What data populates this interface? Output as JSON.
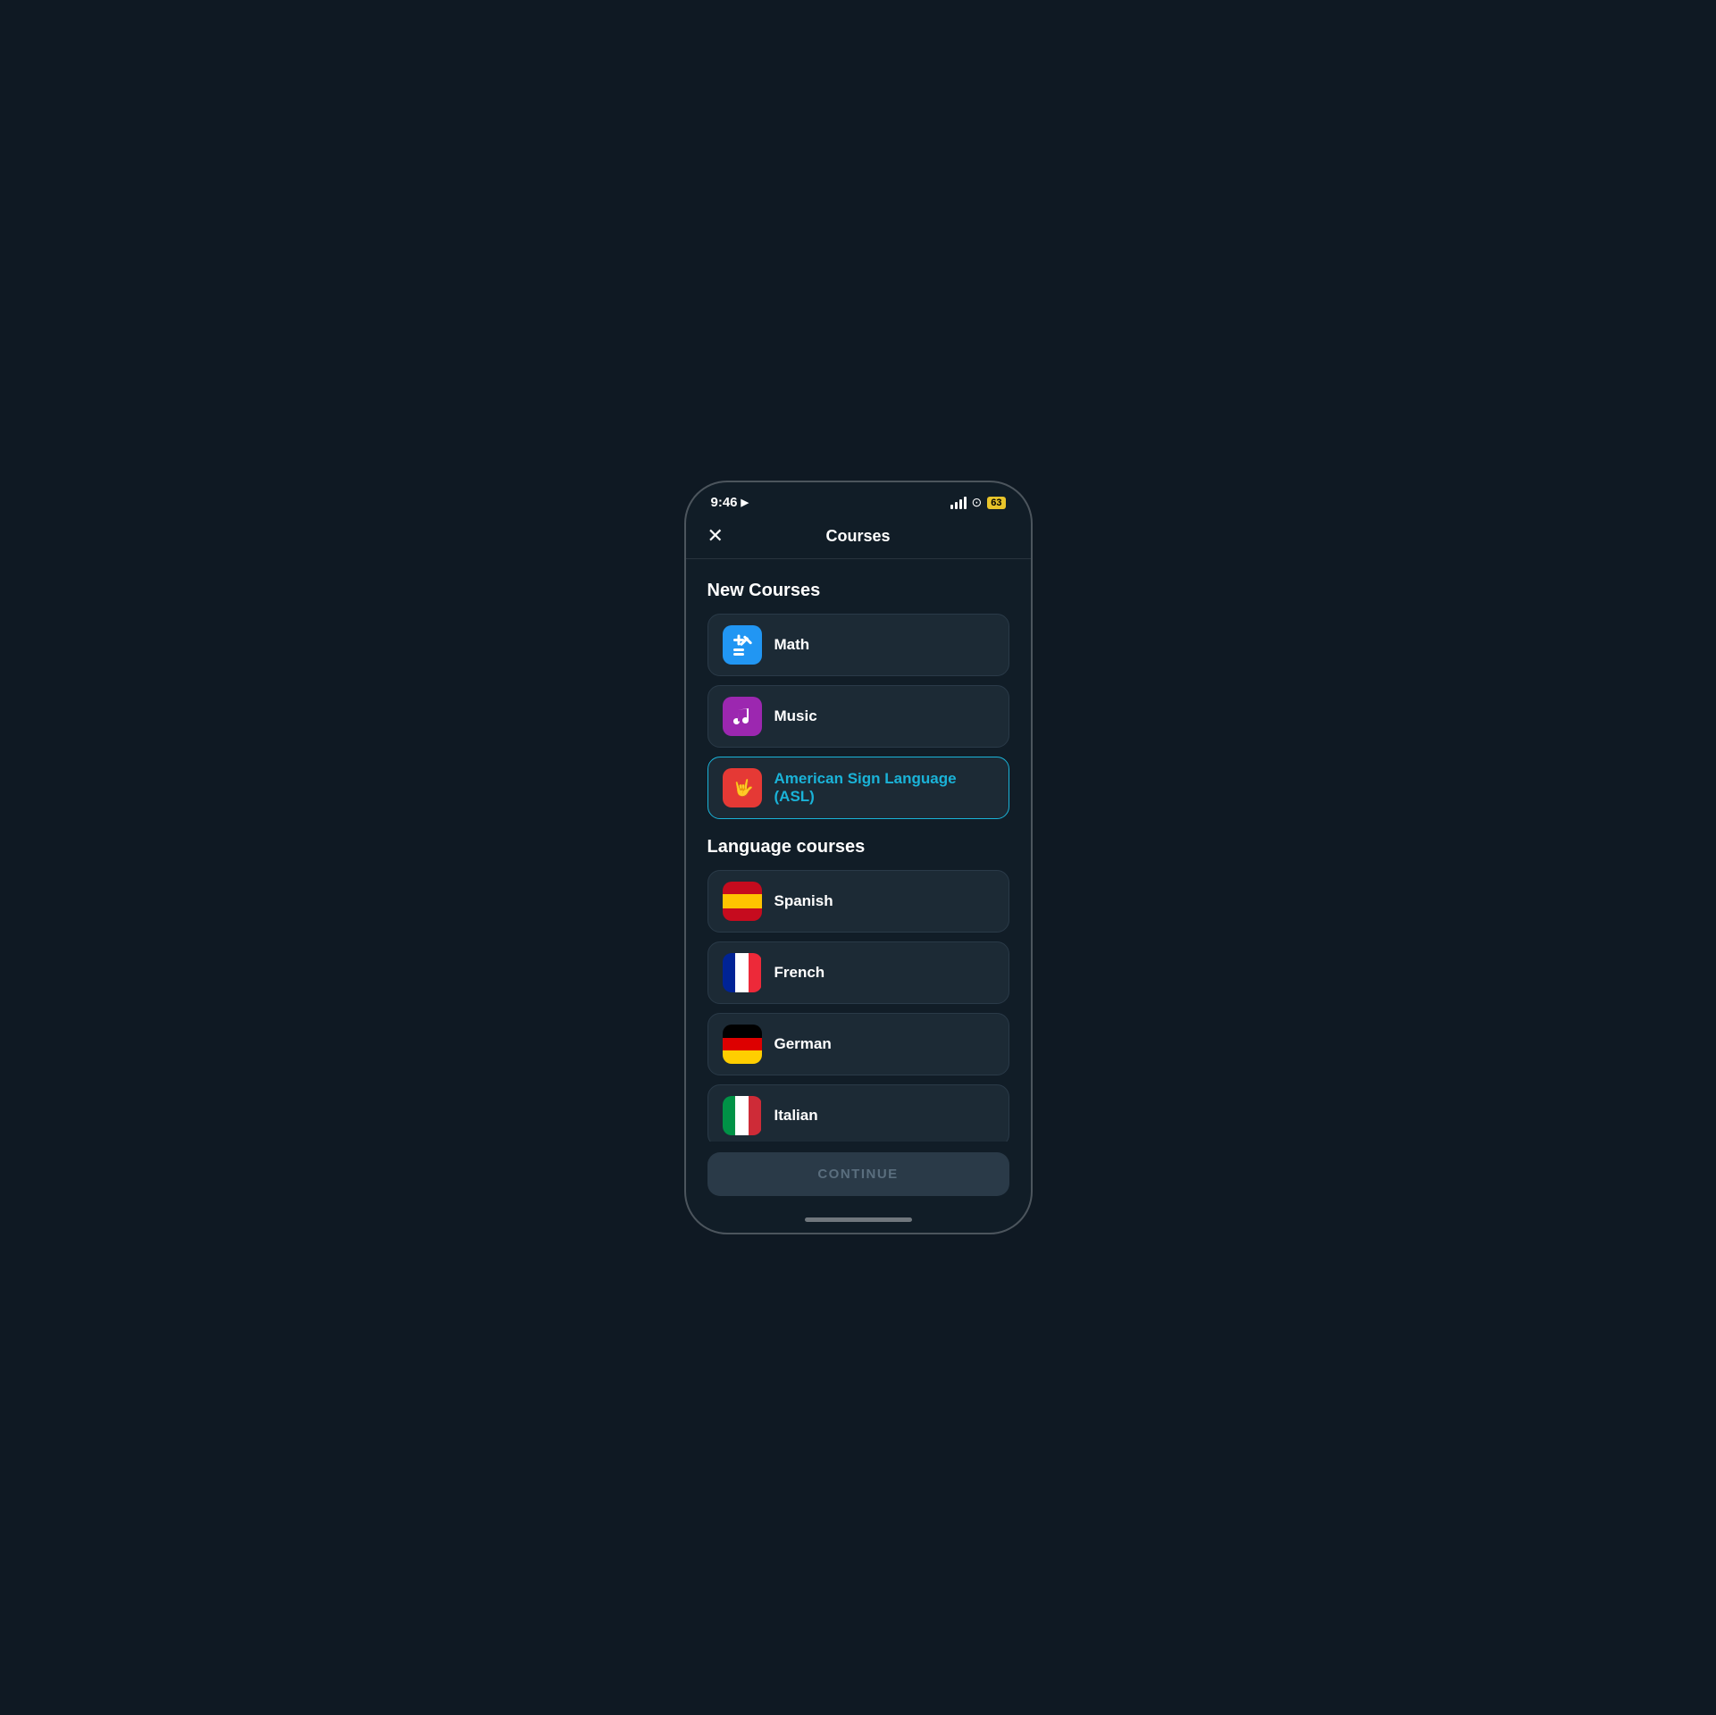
{
  "statusBar": {
    "time": "9:46",
    "battery": "63"
  },
  "header": {
    "title": "Courses",
    "closeLabel": "×"
  },
  "newCourses": {
    "sectionTitle": "New Courses",
    "items": [
      {
        "id": "math",
        "label": "Math",
        "iconType": "math",
        "selected": false
      },
      {
        "id": "music",
        "label": "Music",
        "iconType": "music",
        "selected": false
      },
      {
        "id": "asl",
        "label": "American Sign Language (ASL)",
        "iconType": "asl",
        "selected": true
      }
    ]
  },
  "languageCourses": {
    "sectionTitle": "Language courses",
    "items": [
      {
        "id": "spanish",
        "label": "Spanish",
        "flagType": "spanish",
        "selected": false
      },
      {
        "id": "french",
        "label": "French",
        "flagType": "french",
        "selected": false
      },
      {
        "id": "german",
        "label": "German",
        "flagType": "german",
        "selected": false
      },
      {
        "id": "italian",
        "label": "Italian",
        "flagType": "italian",
        "selected": false
      }
    ]
  },
  "continueButton": {
    "label": "CONTINUE"
  }
}
